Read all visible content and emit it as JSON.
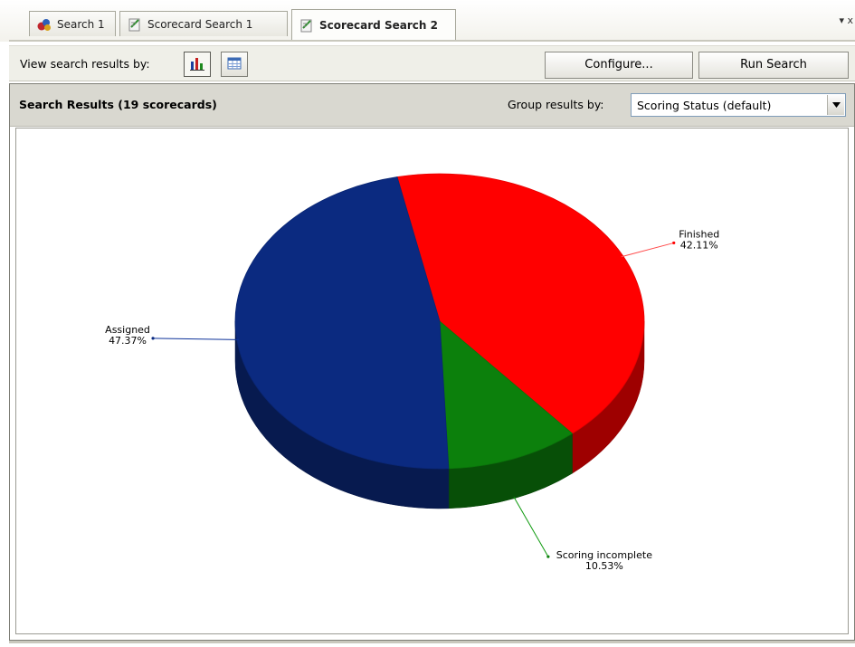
{
  "tabs": [
    {
      "label": "Search 1",
      "icon": "search-people-icon",
      "active": false
    },
    {
      "label": "Scorecard Search 1",
      "icon": "scorecard-icon",
      "active": false
    },
    {
      "label": "Scorecard Search 2",
      "icon": "scorecard-icon",
      "active": true
    }
  ],
  "tab_menu_glyph": "▾ x",
  "toolbar": {
    "view_label": "View search results by:",
    "chart_view_icon": "bar-chart-icon",
    "grid_view_icon": "table-grid-icon",
    "configure_label": "Configure...",
    "run_search_label": "Run Search"
  },
  "results": {
    "title": "Search Results (19 scorecards)",
    "group_label": "Group results by:",
    "group_value": "Scoring Status (default)"
  },
  "colors": {
    "assigned": "#0b2a80",
    "finished": "#ff0000",
    "scoring_incomplete": "#0c800c"
  },
  "chart_data": {
    "type": "pie",
    "style": "3d",
    "slices": [
      {
        "label": "Finished",
        "value": 42.11,
        "display": "42.11%",
        "color": "#ff0000"
      },
      {
        "label": "Scoring incomplete",
        "value": 10.53,
        "display": "10.53%",
        "color": "#0c800c"
      },
      {
        "label": "Assigned",
        "value": 47.37,
        "display": "47.37%",
        "color": "#0b2a80"
      }
    ]
  }
}
